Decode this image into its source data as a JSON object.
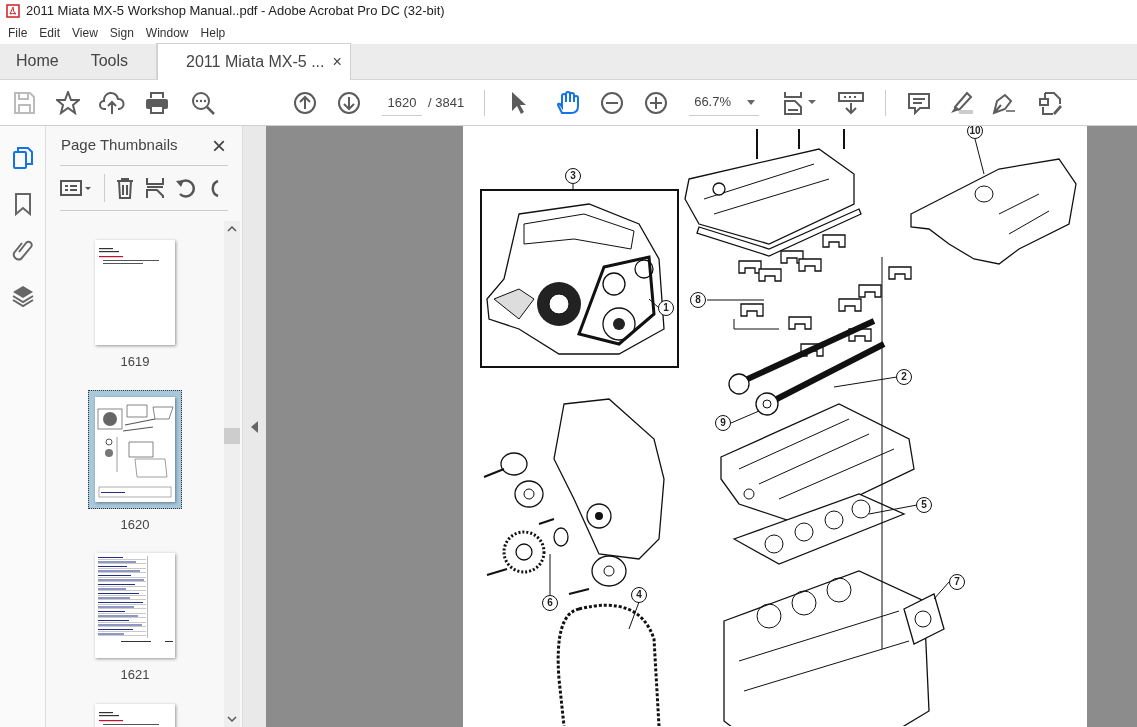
{
  "window": {
    "title": "2011 Miata MX-5 Workshop Manual..pdf - Adobe Acrobat Pro DC (32-bit)"
  },
  "menu": [
    "File",
    "Edit",
    "View",
    "Sign",
    "Window",
    "Help"
  ],
  "tabs": [
    {
      "label": "Home",
      "selected": false
    },
    {
      "label": "Tools",
      "selected": false
    },
    {
      "label": "2011 Miata MX-5 ...",
      "selected": true,
      "close": "×"
    }
  ],
  "toolbar": {
    "page_number": "1620",
    "page_total": "/ 3841",
    "zoom": "66.7%",
    "tools": [
      {
        "selected": false
      },
      {
        "selected": true
      }
    ]
  },
  "rail": [
    {
      "selected": true
    },
    {
      "selected": false
    },
    {
      "selected": false
    },
    {
      "selected": false
    }
  ],
  "panel": {
    "title": "Page Thumbnails",
    "close": "×",
    "thumbnails": [
      {
        "label": "1619",
        "selected": false,
        "kind": "text"
      },
      {
        "label": "1620",
        "selected": true,
        "kind": "diagram"
      },
      {
        "label": "1621",
        "selected": false,
        "kind": "table"
      },
      {
        "selected": false,
        "kind": "text"
      }
    ]
  },
  "diagram": {
    "callouts": [
      "3",
      "1",
      "8",
      "10",
      "2",
      "9",
      "5",
      "7",
      "6",
      "4"
    ]
  }
}
